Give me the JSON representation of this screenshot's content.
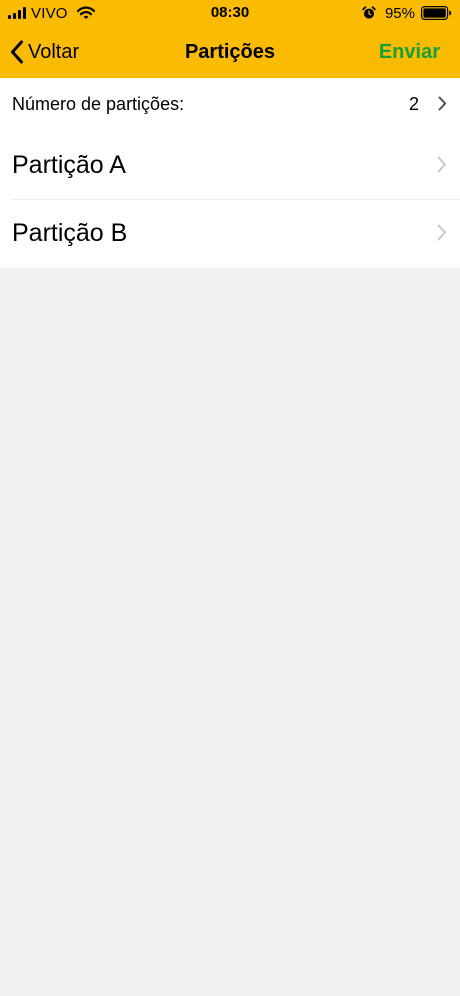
{
  "status_bar": {
    "carrier": "VIVO",
    "time": "08:30",
    "battery_percent": "95%",
    "icons": [
      "signal-icon",
      "wifi-icon",
      "alarm-icon",
      "battery-icon"
    ]
  },
  "nav_bar": {
    "back_label": "Voltar",
    "title": "Partições",
    "action_label": "Enviar",
    "colors": {
      "background": "#fbbb00",
      "action": "#1a9e3c"
    }
  },
  "list": {
    "partition_count_label": "Número de partições:",
    "partition_count_value": "2",
    "partitions": [
      {
        "label": "Partição A"
      },
      {
        "label": "Partição B"
      }
    ]
  },
  "colors": {
    "page_background": "#f1f1f1",
    "row_background": "#ffffff"
  }
}
